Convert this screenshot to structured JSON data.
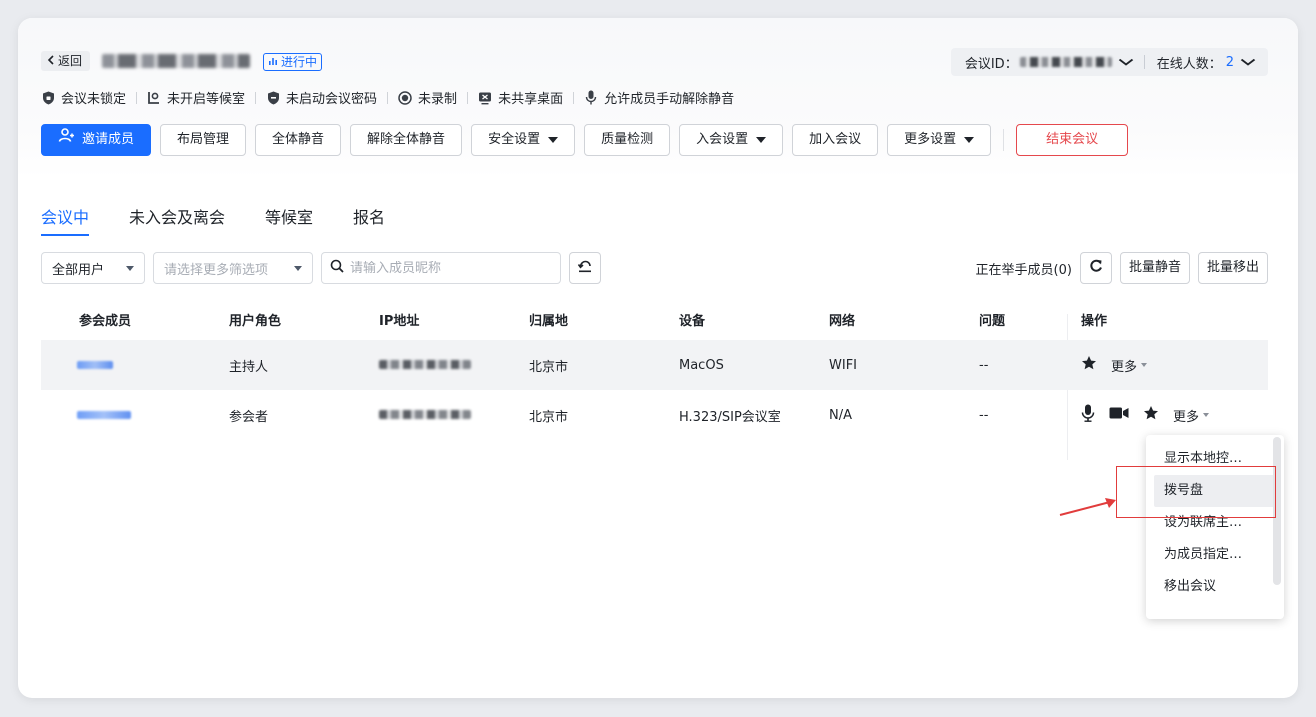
{
  "header": {
    "back_label": "返回",
    "status_tag": "进行中",
    "meeting_id_label": "会议ID：",
    "online_label": "在线人数：",
    "online_count": "2"
  },
  "status_items": [
    {
      "icon": "shield-icon",
      "label": "会议未锁定"
    },
    {
      "icon": "waiting-room-icon",
      "label": "未开启等候室"
    },
    {
      "icon": "password-shield-icon",
      "label": "未启动会议密码"
    },
    {
      "icon": "record-icon",
      "label": "未录制"
    },
    {
      "icon": "screen-share-icon",
      "label": "未共享桌面"
    },
    {
      "icon": "microphone-icon",
      "label": "允许成员手动解除静音"
    }
  ],
  "toolbar": {
    "invite": "邀请成员",
    "layout": "布局管理",
    "mute_all": "全体静音",
    "unmute_all": "解除全体静音",
    "security": "安全设置",
    "quality": "质量检测",
    "join_settings": "入会设置",
    "join_meeting": "加入会议",
    "more_settings": "更多设置",
    "end_meeting": "结束会议"
  },
  "tabs": [
    "会议中",
    "未入会及离会",
    "等候室",
    "报名"
  ],
  "filters": {
    "user_type": "全部用户",
    "more_filters_placeholder": "请选择更多筛选项",
    "search_placeholder": "请输入成员昵称",
    "hand_raised": "正在举手成员(0)",
    "batch_mute": "批量静音",
    "batch_remove": "批量移出"
  },
  "table": {
    "columns": [
      "参会成员",
      "用户角色",
      "IP地址",
      "归属地",
      "设备",
      "网络",
      "问题",
      "操作"
    ],
    "rows": [
      {
        "role": "主持人",
        "location": "北京市",
        "device": "MacOS",
        "network": "WIFI",
        "issue": "--",
        "more": "更多"
      },
      {
        "role": "参会者",
        "location": "北京市",
        "device": "H.323/SIP会议室",
        "network": "N/A",
        "issue": "--",
        "more": "更多"
      }
    ]
  },
  "more_menu": [
    "显示本地控…",
    "拨号盘",
    "设为联席主…",
    "为成员指定…",
    "移出会议"
  ],
  "colors": {
    "accent": "#1a6dff",
    "danger": "#e5484d",
    "annotation": "#e13c3c"
  }
}
